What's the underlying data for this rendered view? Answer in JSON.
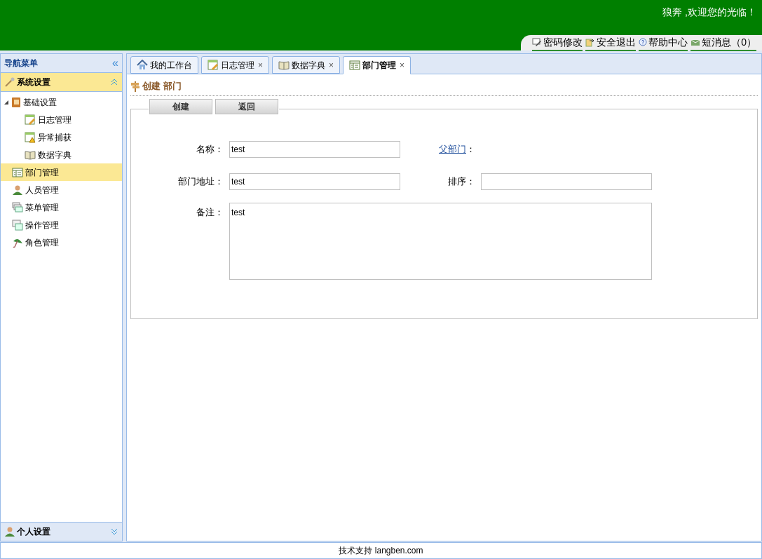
{
  "header": {
    "welcome": "狼奔 ,欢迎您的光临！",
    "links": [
      {
        "kind": "pen",
        "label": "密码修改"
      },
      {
        "kind": "exit",
        "label": "安全退出"
      },
      {
        "kind": "help",
        "label": "帮助中心"
      },
      {
        "kind": "message",
        "label": "短消息（0）"
      }
    ]
  },
  "sidebar": {
    "title": "导航菜单",
    "collapse_glyph": "«",
    "section": {
      "label": "系统设置",
      "expanded": true
    },
    "items": [
      {
        "label": "基础设置",
        "kind": "book",
        "selected": false,
        "expanded": true,
        "children": [
          {
            "label": "日志管理",
            "kind": "log",
            "selected": false
          },
          {
            "label": "异常捕获",
            "kind": "warn",
            "selected": false
          },
          {
            "label": "数据字典",
            "kind": "open-book",
            "selected": false
          }
        ]
      },
      {
        "label": "部门管理",
        "kind": "table",
        "selected": true
      },
      {
        "label": "人员管理",
        "kind": "user",
        "selected": false
      },
      {
        "label": "菜单管理",
        "kind": "windows",
        "selected": false
      },
      {
        "label": "操作管理",
        "kind": "windows2",
        "selected": false
      },
      {
        "label": "角色管理",
        "kind": "umbrella",
        "selected": false
      }
    ],
    "footer_section": {
      "label": "个人设置",
      "expanded": false
    }
  },
  "tabs": [
    {
      "label": "我的工作台",
      "kind": "home",
      "closable": false,
      "selected": false
    },
    {
      "label": "日志管理",
      "kind": "log",
      "closable": true,
      "selected": false
    },
    {
      "label": "数据字典",
      "kind": "open-book",
      "closable": true,
      "selected": false
    },
    {
      "label": "部门管理",
      "kind": "table",
      "closable": true,
      "selected": true
    }
  ],
  "close_glyph": "×",
  "page": {
    "heading": "创建 部门",
    "buttons": [
      "创建",
      "返回"
    ],
    "form": {
      "name": {
        "label": "名称：",
        "value": "test"
      },
      "parent": {
        "label": "父部门",
        "colon": "："
      },
      "address": {
        "label": "部门地址：",
        "value": "test"
      },
      "sort": {
        "label": "排序："
      },
      "remark": {
        "label": "备注：",
        "value": "test"
      }
    }
  },
  "footer": "技术支持 langben.com"
}
